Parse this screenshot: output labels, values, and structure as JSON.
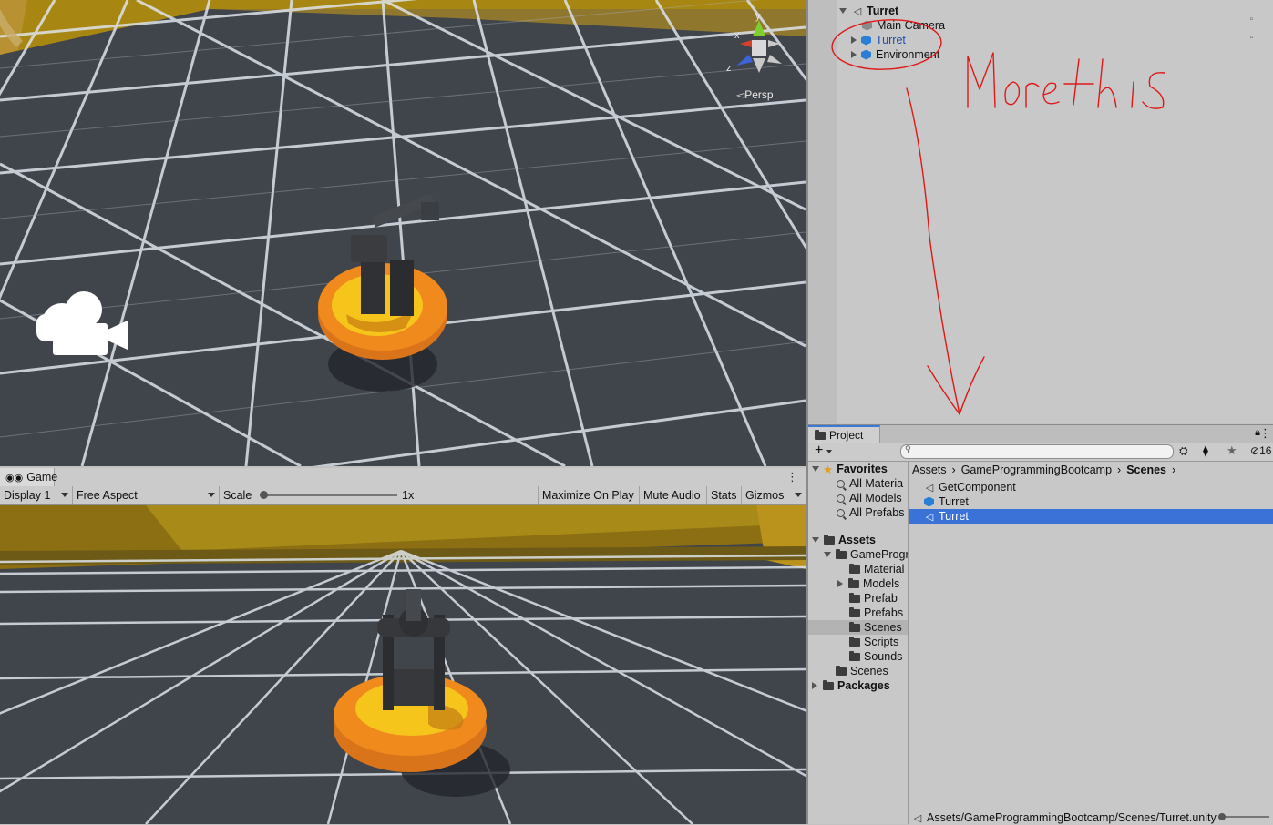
{
  "scene_view": {
    "persp_label": "Persp",
    "gizmo": {
      "x_label": "x",
      "y_label": "y",
      "z_label": "z"
    }
  },
  "game_window": {
    "tab_label": "Game",
    "toolbar": {
      "display": "Display 1",
      "aspect": "Free Aspect",
      "scale_label": "Scale",
      "scale_value": "1x",
      "maximize_on_play": "Maximize On Play",
      "mute_audio": "Mute Audio",
      "stats": "Stats",
      "gizmos": "Gizmos"
    }
  },
  "hierarchy": {
    "scene_name": "Turret",
    "items": [
      {
        "label": "Main Camera"
      },
      {
        "label": "Turret"
      },
      {
        "label": "Environment"
      }
    ],
    "annotation_text": "Move this"
  },
  "project": {
    "tab_label": "Project",
    "breadcrumb": [
      "Assets",
      "GameProgrammingBootcamp",
      "Scenes"
    ],
    "favorites": {
      "header": "Favorites",
      "items": [
        "All Materia",
        "All Models",
        "All Prefabs"
      ]
    },
    "assets": {
      "header": "Assets",
      "game_folder": "GameProgr",
      "subfolders": [
        "Material",
        "Models",
        "Prefab",
        "Prefabs",
        "Scenes",
        "Scripts",
        "Sounds"
      ],
      "scenes_folder": "Scenes"
    },
    "packages_header": "Packages",
    "files": [
      {
        "label": "GetComponent",
        "icon": "unity-scene-icon"
      },
      {
        "label": "Turret",
        "icon": "prefab-cube-icon"
      },
      {
        "label": "Turret",
        "icon": "unity-scene-icon"
      }
    ],
    "status_path": "Assets/GameProgrammingBootcamp/Scenes/Turret.unity",
    "visible_count": "16"
  },
  "colors": {
    "floor": "#3f434a",
    "grid": "#cfd6de",
    "wall": "#a07d12",
    "turret_base": "#f08a1c",
    "turret_top": "#f5c51c",
    "selection": "#3a72d8",
    "annotation": "#e01818"
  }
}
